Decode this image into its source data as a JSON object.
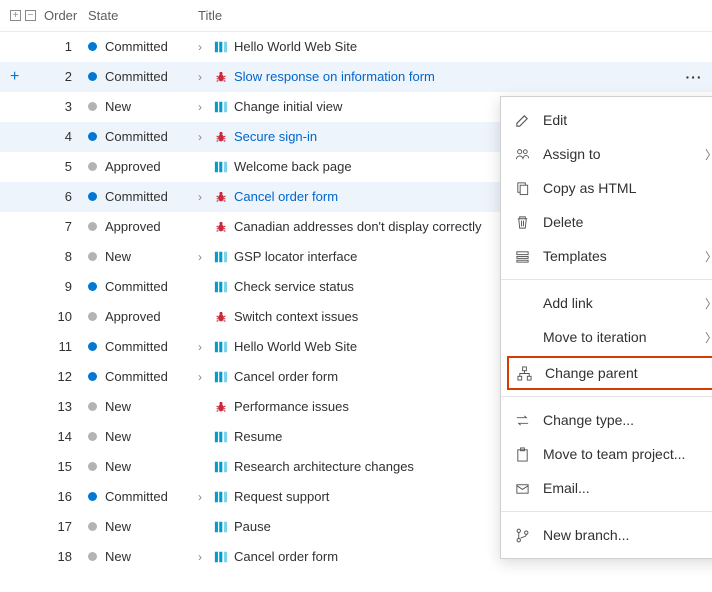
{
  "columns": {
    "order": "Order",
    "state": "State",
    "title": "Title"
  },
  "rows": [
    {
      "order": 1,
      "state": "Committed",
      "dot": "committed",
      "exp": true,
      "kind": "pbi",
      "title": "Hello World Web Site",
      "link": false,
      "sel": false,
      "act": false
    },
    {
      "order": 2,
      "state": "Committed",
      "dot": "committed",
      "exp": true,
      "kind": "bug",
      "title": "Slow response on information form",
      "link": true,
      "sel": true,
      "act": true,
      "add": true
    },
    {
      "order": 3,
      "state": "New",
      "dot": "new",
      "exp": true,
      "kind": "pbi",
      "title": "Change initial view",
      "link": false,
      "sel": false,
      "act": false
    },
    {
      "order": 4,
      "state": "Committed",
      "dot": "committed",
      "exp": true,
      "kind": "bug",
      "title": "Secure sign-in",
      "link": true,
      "sel": true,
      "act": true
    },
    {
      "order": 5,
      "state": "Approved",
      "dot": "approved",
      "exp": false,
      "kind": "pbi",
      "title": "Welcome back page",
      "link": false,
      "sel": false,
      "act": false
    },
    {
      "order": 6,
      "state": "Committed",
      "dot": "committed",
      "exp": true,
      "kind": "bug",
      "title": "Cancel order form",
      "link": true,
      "sel": true,
      "act": true
    },
    {
      "order": 7,
      "state": "Approved",
      "dot": "approved",
      "exp": false,
      "kind": "bug",
      "title": "Canadian addresses don't display correctly",
      "link": false,
      "sel": false,
      "act": false
    },
    {
      "order": 8,
      "state": "New",
      "dot": "new",
      "exp": true,
      "kind": "pbi",
      "title": "GSP locator interface",
      "link": false,
      "sel": false,
      "act": false
    },
    {
      "order": 9,
      "state": "Committed",
      "dot": "committed",
      "exp": false,
      "kind": "pbi",
      "title": "Check service status",
      "link": false,
      "sel": false,
      "act": false
    },
    {
      "order": 10,
      "state": "Approved",
      "dot": "approved",
      "exp": false,
      "kind": "bug",
      "title": "Switch context issues",
      "link": false,
      "sel": false,
      "act": false
    },
    {
      "order": 11,
      "state": "Committed",
      "dot": "committed",
      "exp": true,
      "kind": "pbi",
      "title": "Hello World Web Site",
      "link": false,
      "sel": false,
      "act": false
    },
    {
      "order": 12,
      "state": "Committed",
      "dot": "committed",
      "exp": true,
      "kind": "pbi",
      "title": "Cancel order form",
      "link": false,
      "sel": false,
      "act": false
    },
    {
      "order": 13,
      "state": "New",
      "dot": "new",
      "exp": false,
      "kind": "bug",
      "title": "Performance issues",
      "link": false,
      "sel": false,
      "act": false
    },
    {
      "order": 14,
      "state": "New",
      "dot": "new",
      "exp": false,
      "kind": "pbi",
      "title": "Resume",
      "link": false,
      "sel": false,
      "act": false
    },
    {
      "order": 15,
      "state": "New",
      "dot": "new",
      "exp": false,
      "kind": "pbi",
      "title": "Research architecture changes",
      "link": false,
      "sel": false,
      "act": false
    },
    {
      "order": 16,
      "state": "Committed",
      "dot": "committed",
      "exp": true,
      "kind": "pbi",
      "title": "Request support",
      "link": false,
      "sel": false,
      "act": false
    },
    {
      "order": 17,
      "state": "New",
      "dot": "new",
      "exp": false,
      "kind": "pbi",
      "title": "Pause",
      "link": false,
      "sel": false,
      "act": false
    },
    {
      "order": 18,
      "state": "New",
      "dot": "new",
      "exp": true,
      "kind": "pbi",
      "title": "Cancel order form",
      "link": false,
      "sel": false,
      "act": false
    }
  ],
  "menu": {
    "edit": "Edit",
    "assign_to": "Assign to",
    "copy_html": "Copy as HTML",
    "delete": "Delete",
    "templates": "Templates",
    "add_link": "Add link",
    "move_iter": "Move to iteration",
    "change_parent": "Change parent",
    "change_type": "Change type...",
    "move_team": "Move to team project...",
    "email": "Email...",
    "new_branch": "New branch..."
  }
}
